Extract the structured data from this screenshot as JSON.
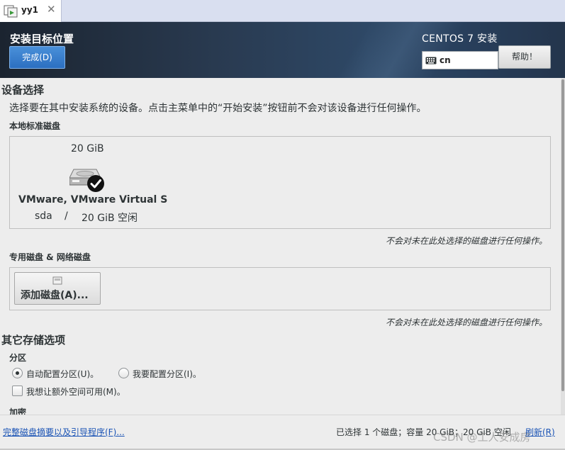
{
  "vm_tab": {
    "title": "yy1",
    "close": "✕",
    "icon": "vm-window-icon"
  },
  "header": {
    "title": "安装目标位置",
    "done_label": "完成(D)",
    "product": "CENTOS 7 安装",
    "keyboard_layout": "cn",
    "help_label": "帮助！"
  },
  "device_selection": {
    "heading": "设备选择",
    "description": "选择要在其中安装系统的设备。点击主菜单中的“开始安装”按钮前不会对该设备进行任何操作。"
  },
  "local_disks": {
    "heading": "本地标准磁盘",
    "disks": [
      {
        "size": "20 GiB",
        "name": "VMware, VMware Virtual S",
        "device": "sda",
        "separator": "/",
        "free": "20 GiB 空闲",
        "selected": true
      }
    ],
    "note": "不会对未在此处选择的磁盘进行任何操作。"
  },
  "network_disks": {
    "heading": "专用磁盘 & 网络磁盘",
    "add_label": "添加磁盘(A)...",
    "note": "不会对未在此处选择的磁盘进行任何操作。"
  },
  "other_storage": {
    "heading": "其它存储选项",
    "partition_heading": "分区",
    "auto_label": "自动配置分区(U)。",
    "manual_label": "我要配置分区(I)。",
    "selected_partitioning": "auto",
    "extra_space_label": "我想让额外空间可用(M)。",
    "extra_space_checked": false,
    "encryption_heading": "加密"
  },
  "footer": {
    "summary_link": "完整磁盘摘要以及引导程序(F)...",
    "status": "已选择 1 个磁盘；容量 20 GiB；20 GiB 空闲",
    "refresh": "刷新(R)",
    "watermark": "CSDN @工人安成房"
  },
  "colors": {
    "accent": "#2c6fc1",
    "link": "#1a53b5",
    "header_dark": "#1b2430"
  }
}
